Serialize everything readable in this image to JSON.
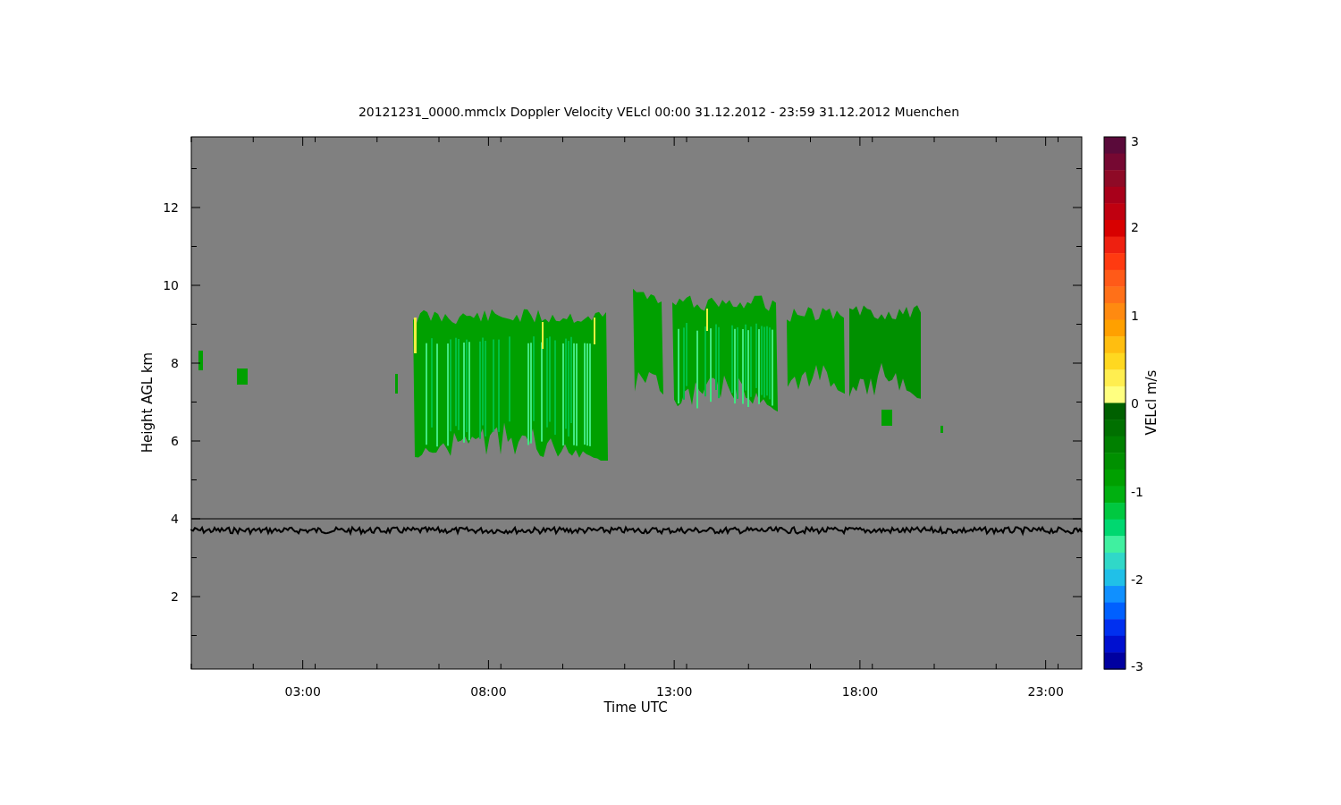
{
  "title": "20121231_0000.mmclx Doppler Velocity VELcl   00:00 31.12.2012 - 23:59 31.12.2012 Muenchen",
  "plot": {
    "ylabel": "Height AGL km",
    "xlabel": "Time UTC",
    "yticks": [
      "12",
      "10",
      "8",
      "6",
      "4",
      "2"
    ],
    "xticks": [
      "03:00",
      "08:00",
      "13:00",
      "18:00",
      "23:00"
    ]
  },
  "colorbar": {
    "label": "VELcl m/s",
    "ticks": [
      "3",
      "2",
      "1",
      "0",
      "-1",
      "-2",
      "-3"
    ]
  }
}
